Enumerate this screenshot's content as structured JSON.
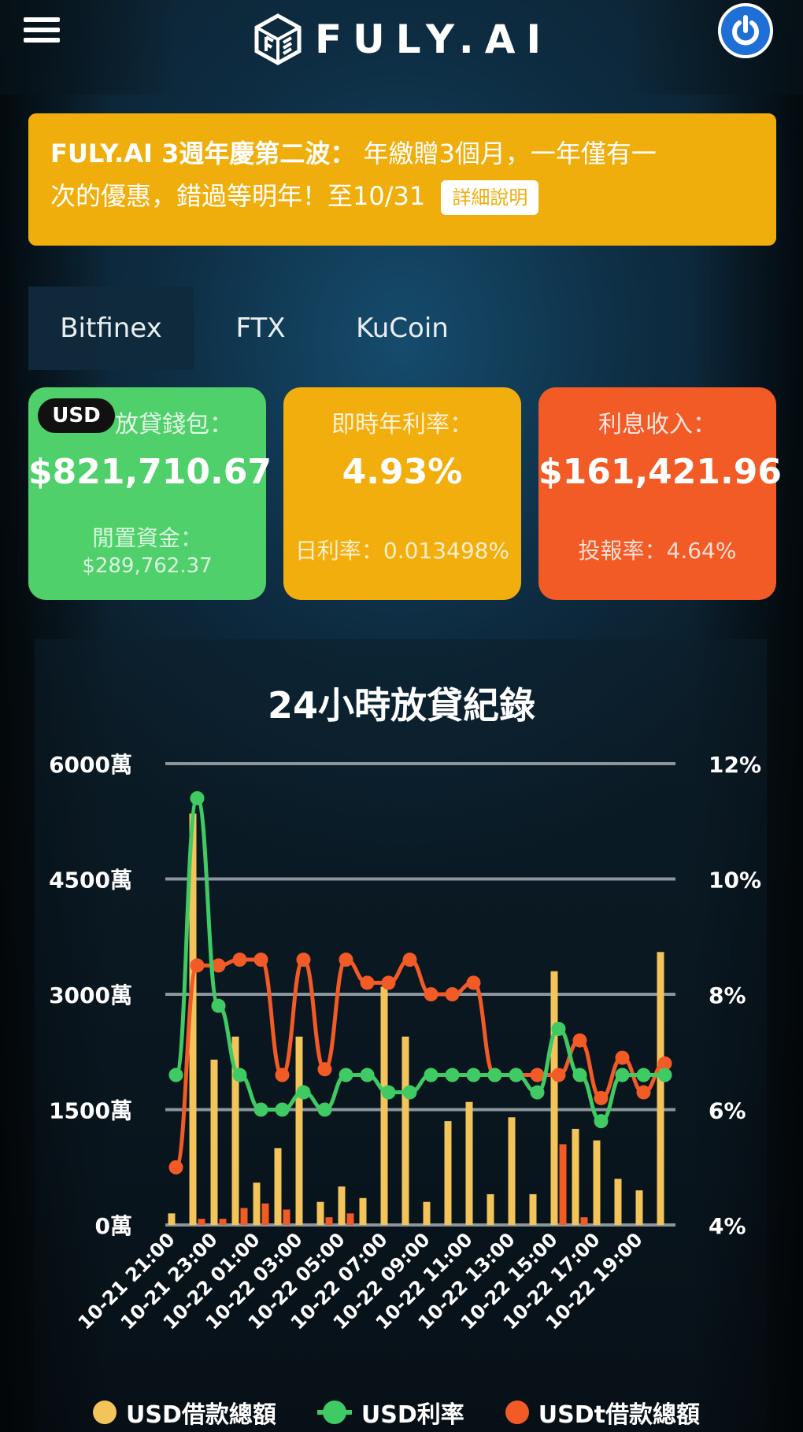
{
  "header": {
    "brand": "FULY.AI"
  },
  "banner": {
    "title": "FULY.AI 3週年慶第二波：",
    "text_line1": "年繳贈3個月，一年僅有一",
    "text_line2": "次的優惠，錯過等明年！至10/31",
    "details_label": "詳細說明",
    "color": "#f0ae0c"
  },
  "tabs": [
    {
      "label": "Bitfinex",
      "active": true
    },
    {
      "label": "FTX",
      "active": false
    },
    {
      "label": "KuCoin",
      "active": false
    }
  ],
  "cards": {
    "lending": {
      "currency": "USD",
      "label": "放貸錢包：",
      "value": "$821,710.67",
      "sub_label": "閒置資金：",
      "sub_value": "$289,762.37",
      "color": "#4fd06a"
    },
    "rate": {
      "label": "即時年利率：",
      "value": "4.93%",
      "sub": "日利率：0.013498%",
      "color": "#f2ae0c"
    },
    "income": {
      "label": "利息收入：",
      "value": "$161,421.96",
      "sub": "投報率：4.64%",
      "color": "#f25a26"
    }
  },
  "chart_data": {
    "type": "bar",
    "title": "24小時放貸紀錄",
    "y_left": {
      "ticks": [
        "6000萬",
        "4500萬",
        "3000萬",
        "1500萬",
        "0萬"
      ],
      "min": 0,
      "max": 6000,
      "unit": "萬"
    },
    "y_right": {
      "ticks": [
        "12%",
        "10%",
        "8%",
        "6%",
        "4%"
      ],
      "min": 4,
      "max": 12,
      "unit": "%"
    },
    "x_labels": [
      "10-21 21:00",
      "10-21 23:00",
      "10-22 01:00",
      "10-22 03:00",
      "10-22 05:00",
      "10-22 07:00",
      "10-22 09:00",
      "10-22 11:00",
      "10-22 13:00",
      "10-22 15:00",
      "10-22 17:00",
      "10-22 19:00"
    ],
    "grid": true,
    "legend_position": "bottom",
    "series": [
      {
        "name": "USD借款總額",
        "kind": "bar",
        "axis": "left",
        "color": "#f2c45a",
        "values": [
          150,
          5350,
          2150,
          2450,
          550,
          1000,
          2450,
          300,
          500,
          350,
          3100,
          2450,
          300,
          1350,
          1600,
          400,
          1400,
          400,
          3300,
          1250,
          1100,
          600,
          450,
          3550
        ]
      },
      {
        "name": "USDt借款總額",
        "kind": "bar",
        "axis": "left",
        "color": "#f25a26",
        "values": [
          0,
          80,
          80,
          220,
          280,
          200,
          0,
          100,
          150,
          0,
          0,
          0,
          0,
          0,
          0,
          0,
          0,
          0,
          1050,
          100,
          0,
          0,
          0,
          0
        ]
      },
      {
        "name": "USD利率",
        "kind": "line",
        "axis": "right",
        "color": "#3fca63",
        "values": [
          6.6,
          11.4,
          7.8,
          6.6,
          6.0,
          6.0,
          6.3,
          6.0,
          6.6,
          6.6,
          6.3,
          6.3,
          6.6,
          6.6,
          6.6,
          6.6,
          6.6,
          6.3,
          7.4,
          6.6,
          5.8,
          6.6,
          6.6,
          6.6
        ]
      },
      {
        "name": "USDt借款總額",
        "kind": "line",
        "axis": "right",
        "color": "#f25a26",
        "values": [
          5.0,
          8.5,
          8.5,
          8.6,
          8.6,
          6.6,
          8.6,
          6.7,
          8.6,
          8.2,
          8.2,
          8.6,
          8.0,
          8.0,
          8.2,
          6.6,
          6.6,
          6.6,
          6.6,
          7.2,
          6.2,
          6.9,
          6.3,
          6.8
        ]
      }
    ],
    "legend": [
      {
        "name": "USD借款總額",
        "marker": "dot",
        "color": "#f2c45a"
      },
      {
        "name": "USD利率",
        "marker": "line-dot",
        "color": "#3fca63"
      },
      {
        "name": "USDt借款總額",
        "marker": "dot",
        "color": "#f25a26"
      }
    ]
  }
}
